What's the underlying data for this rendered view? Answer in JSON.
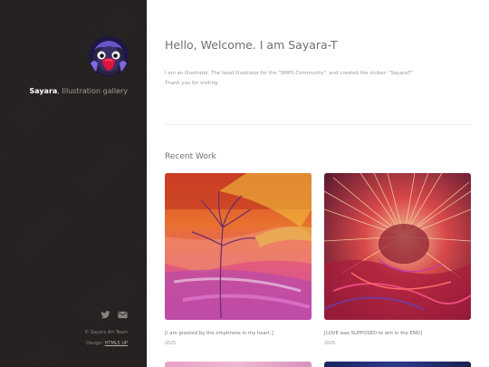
{
  "sidebar": {
    "avatar_icon": "penguin-avatar",
    "site_name": "Sayara",
    "site_subtitle": ", Illustration gallery",
    "social": [
      {
        "icon": "twitter-icon"
      },
      {
        "icon": "envelope-icon"
      }
    ],
    "copyright": "© Sayara Art Team",
    "design_prefix": "Design: ",
    "design_link": "HTML5 UP"
  },
  "main": {
    "greeting": "Hello, Welcome. I am Sayara-T",
    "intro_line1": "I am an Illustrator. The head Illustrator for the \"SMPS Community\", and created the vtuber- \"SayaraT\"",
    "intro_line2": "Thank you for visiting.",
    "recent_heading": "Recent Work",
    "works": [
      {
        "caption": "[I am greeted by the emptiness in my heart.]",
        "year": "2025"
      },
      {
        "caption": "[LOVE was SUPPOSED to win in the END]",
        "year": "2025"
      }
    ]
  },
  "colors": {
    "sidebar_bg": "#262221",
    "heading": "#6f6f6f",
    "accent_avatar": "#e0143c"
  }
}
